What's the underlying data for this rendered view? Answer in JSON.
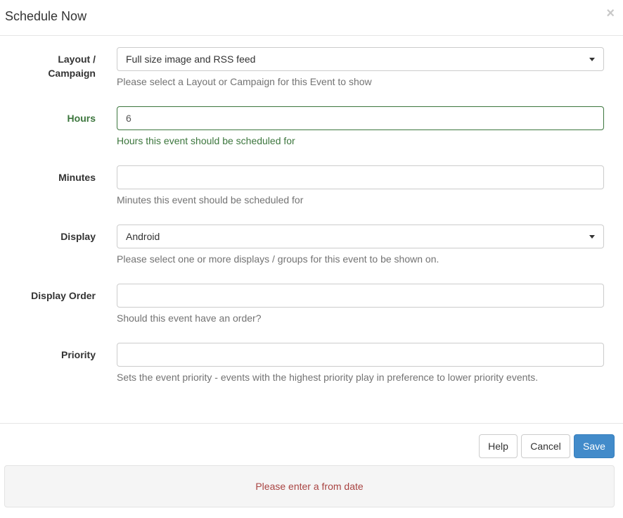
{
  "modal": {
    "title": "Schedule Now",
    "close_symbol": "×"
  },
  "fields": {
    "layout": {
      "label_line1": "Layout /",
      "label_line2": "Campaign",
      "value": "Full size image and RSS feed",
      "help": "Please select a Layout or Campaign for this Event to show"
    },
    "hours": {
      "label": "Hours",
      "value": "6",
      "help": "Hours this event should be scheduled for"
    },
    "minutes": {
      "label": "Minutes",
      "value": "",
      "help": "Minutes this event should be scheduled for"
    },
    "display": {
      "label": "Display",
      "value": "Android",
      "help": "Please select one or more displays / groups for this event to be shown on."
    },
    "display_order": {
      "label": "Display Order",
      "value": "",
      "help": "Should this event have an order?"
    },
    "priority": {
      "label": "Priority",
      "value": "",
      "help": "Sets the event priority - events with the highest priority play in preference to lower priority events."
    }
  },
  "footer": {
    "help_label": "Help",
    "cancel_label": "Cancel",
    "save_label": "Save"
  },
  "alert": {
    "message": "Please enter a from date"
  },
  "colors": {
    "success": "#3c763d",
    "primary": "#428bca",
    "error_text": "#a94442"
  }
}
